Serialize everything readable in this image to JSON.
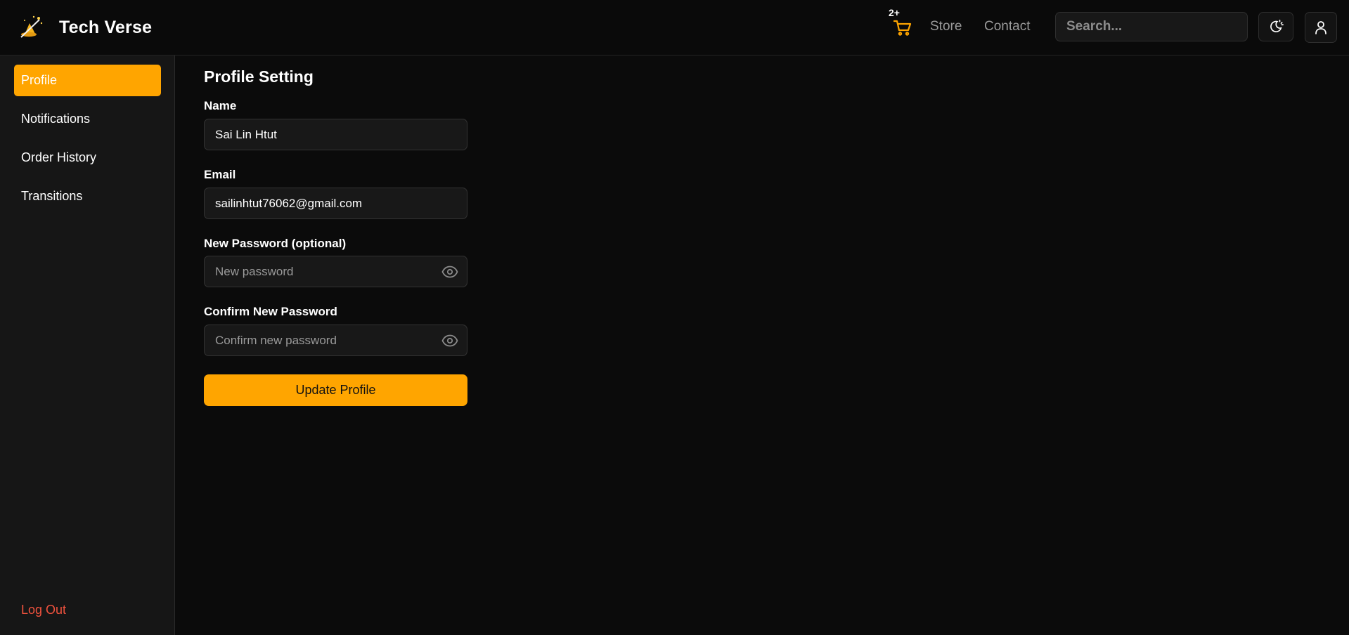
{
  "header": {
    "brand_name": "Tech Verse",
    "logo_icon": "magic-hat-wand-icon",
    "cart_badge": "2+",
    "cart_icon": "shopping-cart-icon",
    "nav": {
      "store": "Store",
      "contact": "Contact"
    },
    "search": {
      "placeholder": "Search...",
      "value": ""
    },
    "theme_icon": "moon-sun-icon",
    "user_icon": "user-icon"
  },
  "sidebar": {
    "items": [
      {
        "label": "Profile",
        "active": true
      },
      {
        "label": "Notifications",
        "active": false
      },
      {
        "label": "Order History",
        "active": false
      },
      {
        "label": "Transitions",
        "active": false
      }
    ],
    "logout": "Log Out"
  },
  "main": {
    "title": "Profile Setting",
    "fields": {
      "name": {
        "label": "Name",
        "value": "Sai Lin Htut"
      },
      "email": {
        "label": "Email",
        "value": "sailinhtut76062@gmail.com"
      },
      "new_password": {
        "label": "New Password (optional)",
        "placeholder": "New password"
      },
      "confirm_password": {
        "label": "Confirm New Password",
        "placeholder": "Confirm new password"
      }
    },
    "submit": "Update Profile"
  },
  "colors": {
    "accent": "#ffa500",
    "background": "#0b0b0b",
    "sidebar": "#161616",
    "logout": "#f0523e"
  }
}
